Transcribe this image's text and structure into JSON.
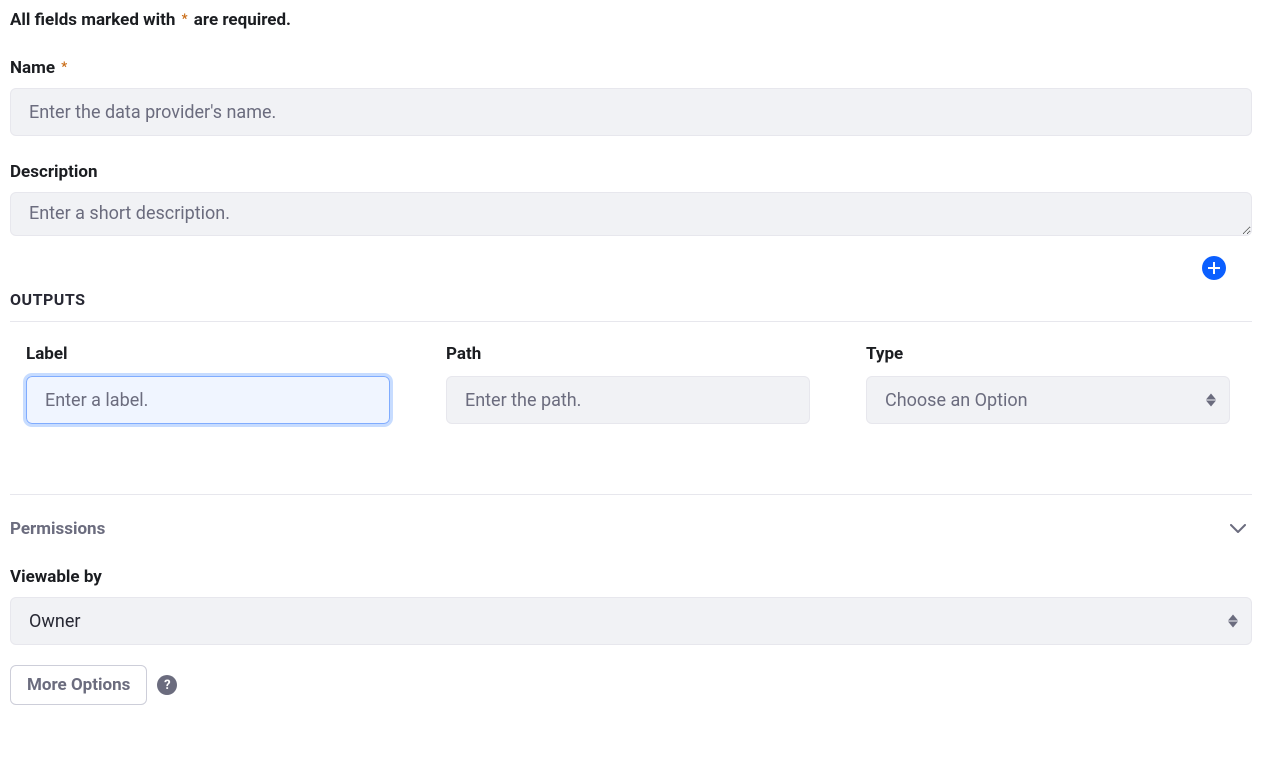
{
  "required_note_before": "All fields marked with",
  "required_note_after": "are required.",
  "asterisk": "*",
  "name": {
    "label": "Name",
    "placeholder": "Enter the data provider's name."
  },
  "description": {
    "label": "Description",
    "placeholder": "Enter a short description."
  },
  "outputs": {
    "title": "OUTPUTS",
    "label_col": "Label",
    "path_col": "Path",
    "type_col": "Type",
    "label_placeholder": "Enter a label.",
    "path_placeholder": "Enter the path.",
    "type_placeholder": "Choose an Option"
  },
  "permissions": {
    "title": "Permissions",
    "viewable_label": "Viewable by",
    "viewable_value": "Owner",
    "more_options": "More Options",
    "help_symbol": "?"
  }
}
